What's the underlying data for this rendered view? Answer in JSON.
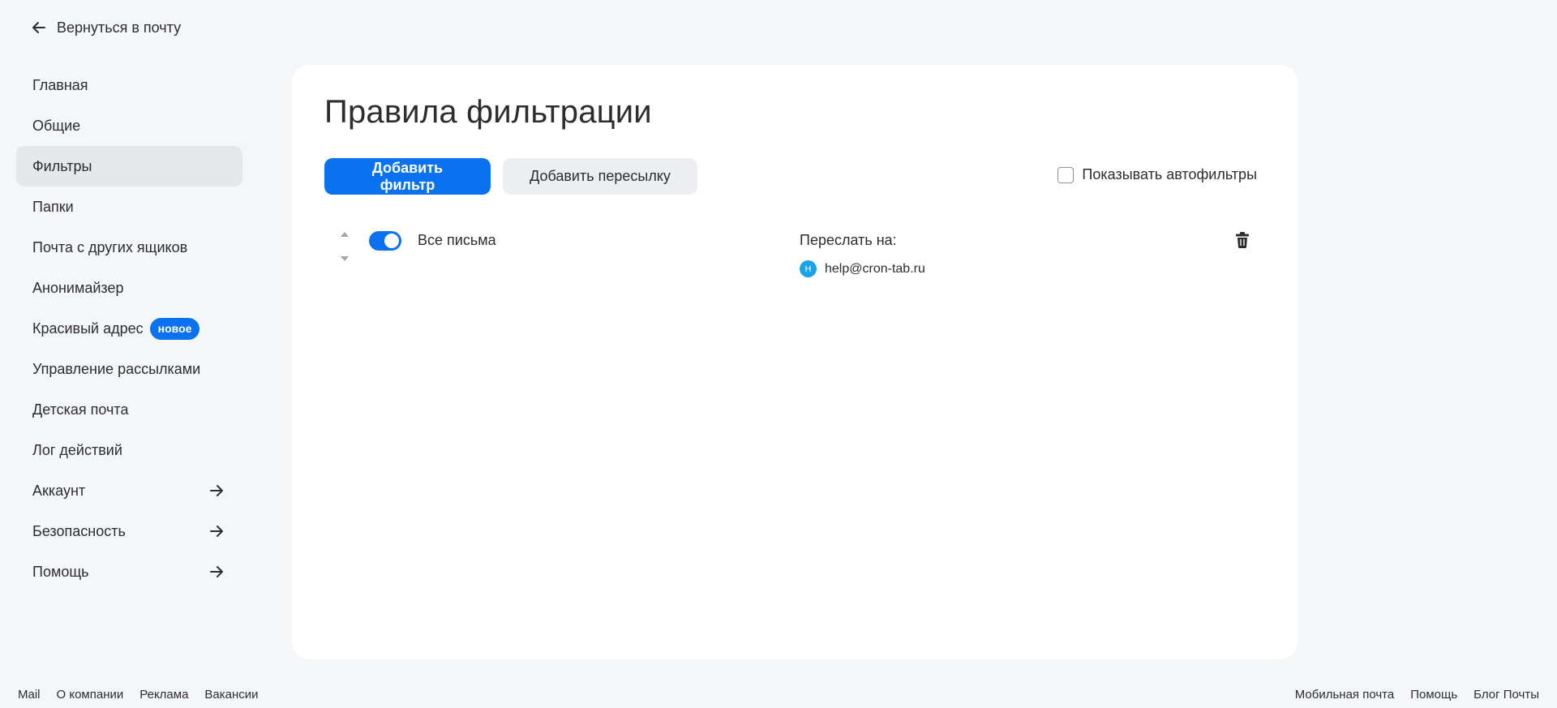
{
  "back_link": {
    "label": "Вернуться в почту",
    "icon": "arrow-left-icon"
  },
  "sidebar": {
    "items": [
      {
        "label": "Главная"
      },
      {
        "label": "Общие"
      },
      {
        "label": "Фильтры",
        "active": true
      },
      {
        "label": "Папки"
      },
      {
        "label": "Почта с других ящиков"
      },
      {
        "label": "Анонимайзер"
      },
      {
        "label": "Красивый адрес",
        "badge": "новое"
      },
      {
        "label": "Управление рассылками"
      },
      {
        "label": "Детская почта"
      },
      {
        "label": "Лог действий"
      },
      {
        "label": "Аккаунт",
        "icon": "arrow-right-icon"
      },
      {
        "label": "Безопасность",
        "icon": "arrow-right-icon"
      },
      {
        "label": "Помощь",
        "icon": "arrow-right-icon"
      }
    ]
  },
  "main": {
    "title": "Правила фильтрации",
    "add_filter_label": "Добавить фильтр",
    "add_forward_label": "Добавить пересылку",
    "show_autofilters_label": "Показывать автофильтры",
    "show_autofilters_checked": false,
    "filters": [
      {
        "name": "Все письма",
        "enabled": true,
        "action_label": "Переслать на:",
        "recipient_initial": "H",
        "recipient_email": "help@cron-tab.ru"
      }
    ]
  },
  "footer": {
    "left": [
      "Mail",
      "О компании",
      "Реклама",
      "Вакансии"
    ],
    "right": [
      "Мобильная почта",
      "Помощь",
      "Блог Почты"
    ]
  },
  "colors": {
    "accent": "#0a72ef",
    "background": "#f5f6f8",
    "card": "#ffffff",
    "active_nav": "#e6e7eb",
    "avatar": "#1aa3e8"
  }
}
